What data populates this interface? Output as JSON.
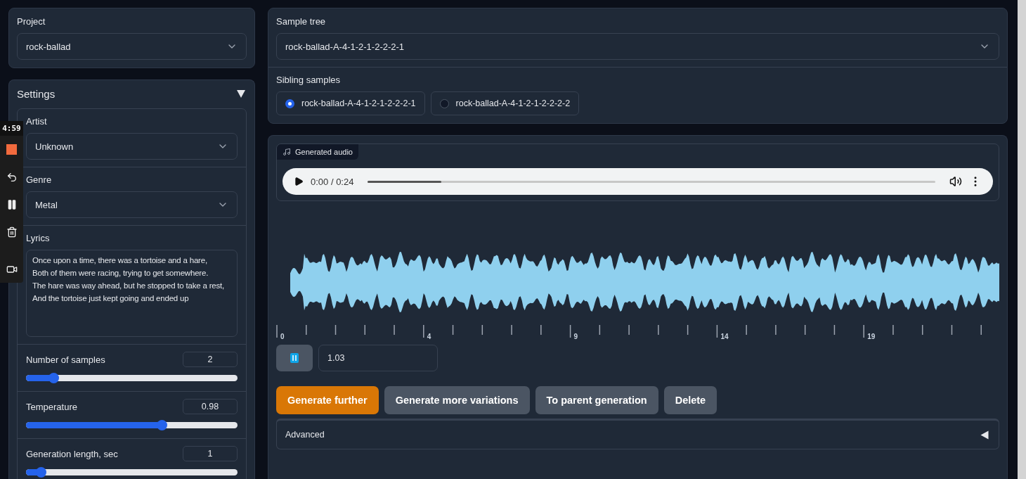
{
  "project": {
    "label": "Project",
    "value": "rock-ballad"
  },
  "settings": {
    "title": "Settings",
    "expanded": true,
    "artist": {
      "label": "Artist",
      "value": "Unknown"
    },
    "genre": {
      "label": "Genre",
      "value": "Metal"
    },
    "lyrics": {
      "label": "Lyrics",
      "value": "Once upon a time, there was a tortoise and a hare,\nBoth of them were racing, trying to get somewhere.\nThe hare was way ahead, but he stopped to take a rest,\nAnd the tortoise just kept going and ended up"
    },
    "sliders": [
      {
        "label": "Number of samples",
        "value": "2",
        "level": 0.13
      },
      {
        "label": "Temperature",
        "value": "0.98",
        "level": 0.64
      },
      {
        "label": "Generation length, sec",
        "value": "1",
        "level": 0.07
      }
    ]
  },
  "recorder": {
    "time": "4:59"
  },
  "sample_tree": {
    "label": "Sample tree",
    "value": "rock-ballad-A-4-1-2-1-2-2-2-1"
  },
  "siblings": {
    "label": "Sibling samples",
    "items": [
      {
        "label": "rock-ballad-A-4-1-2-1-2-2-2-1",
        "selected": true
      },
      {
        "label": "rock-ballad-A-4-1-2-1-2-2-2-2",
        "selected": false
      }
    ]
  },
  "audio": {
    "label": "Generated audio",
    "time": "0:00 / 0:24",
    "level": 0.13
  },
  "timeline_labels": [
    "0",
    "4",
    "9",
    "14",
    "19"
  ],
  "trim_value": "1.03",
  "buttons": [
    {
      "label": "Generate further",
      "kind": "primary"
    },
    {
      "label": "Generate more variations",
      "kind": "secondary"
    },
    {
      "label": "To parent generation",
      "kind": "secondary"
    },
    {
      "label": "Delete",
      "kind": "secondary"
    }
  ],
  "advanced": {
    "label": "Advanced",
    "expanded": false
  }
}
